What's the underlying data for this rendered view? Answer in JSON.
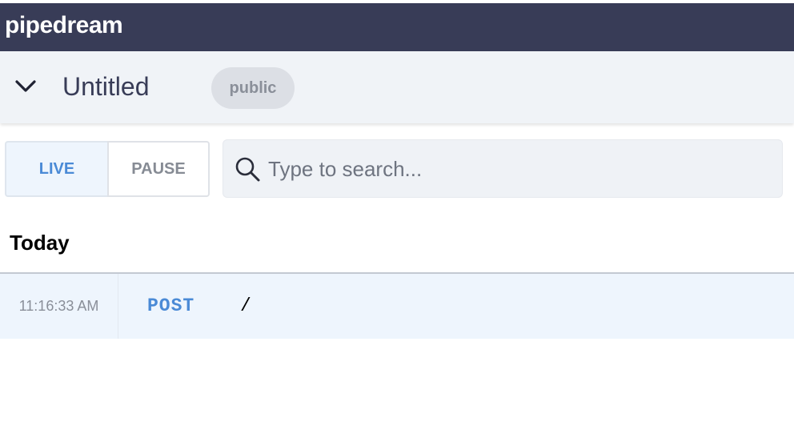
{
  "app": {
    "brand": "pipedream"
  },
  "header": {
    "title": "Untitled",
    "visibility_badge": "public",
    "collapse_icon": "chevron-down-icon"
  },
  "controls": {
    "live_label": "LIVE",
    "pause_label": "PAUSE",
    "active_mode": "LIVE",
    "search_placeholder": "Type to search...",
    "search_value": "",
    "search_icon": "search-icon"
  },
  "events": {
    "section_title": "Today",
    "rows": [
      {
        "time": "11:16:33 AM",
        "method": "POST",
        "path": "/"
      }
    ]
  },
  "colors": {
    "topbar": "#383c57",
    "accent": "#4a8ad6",
    "subheader_bg": "#f0f3f7",
    "selected_row_bg": "#eef5fd"
  }
}
